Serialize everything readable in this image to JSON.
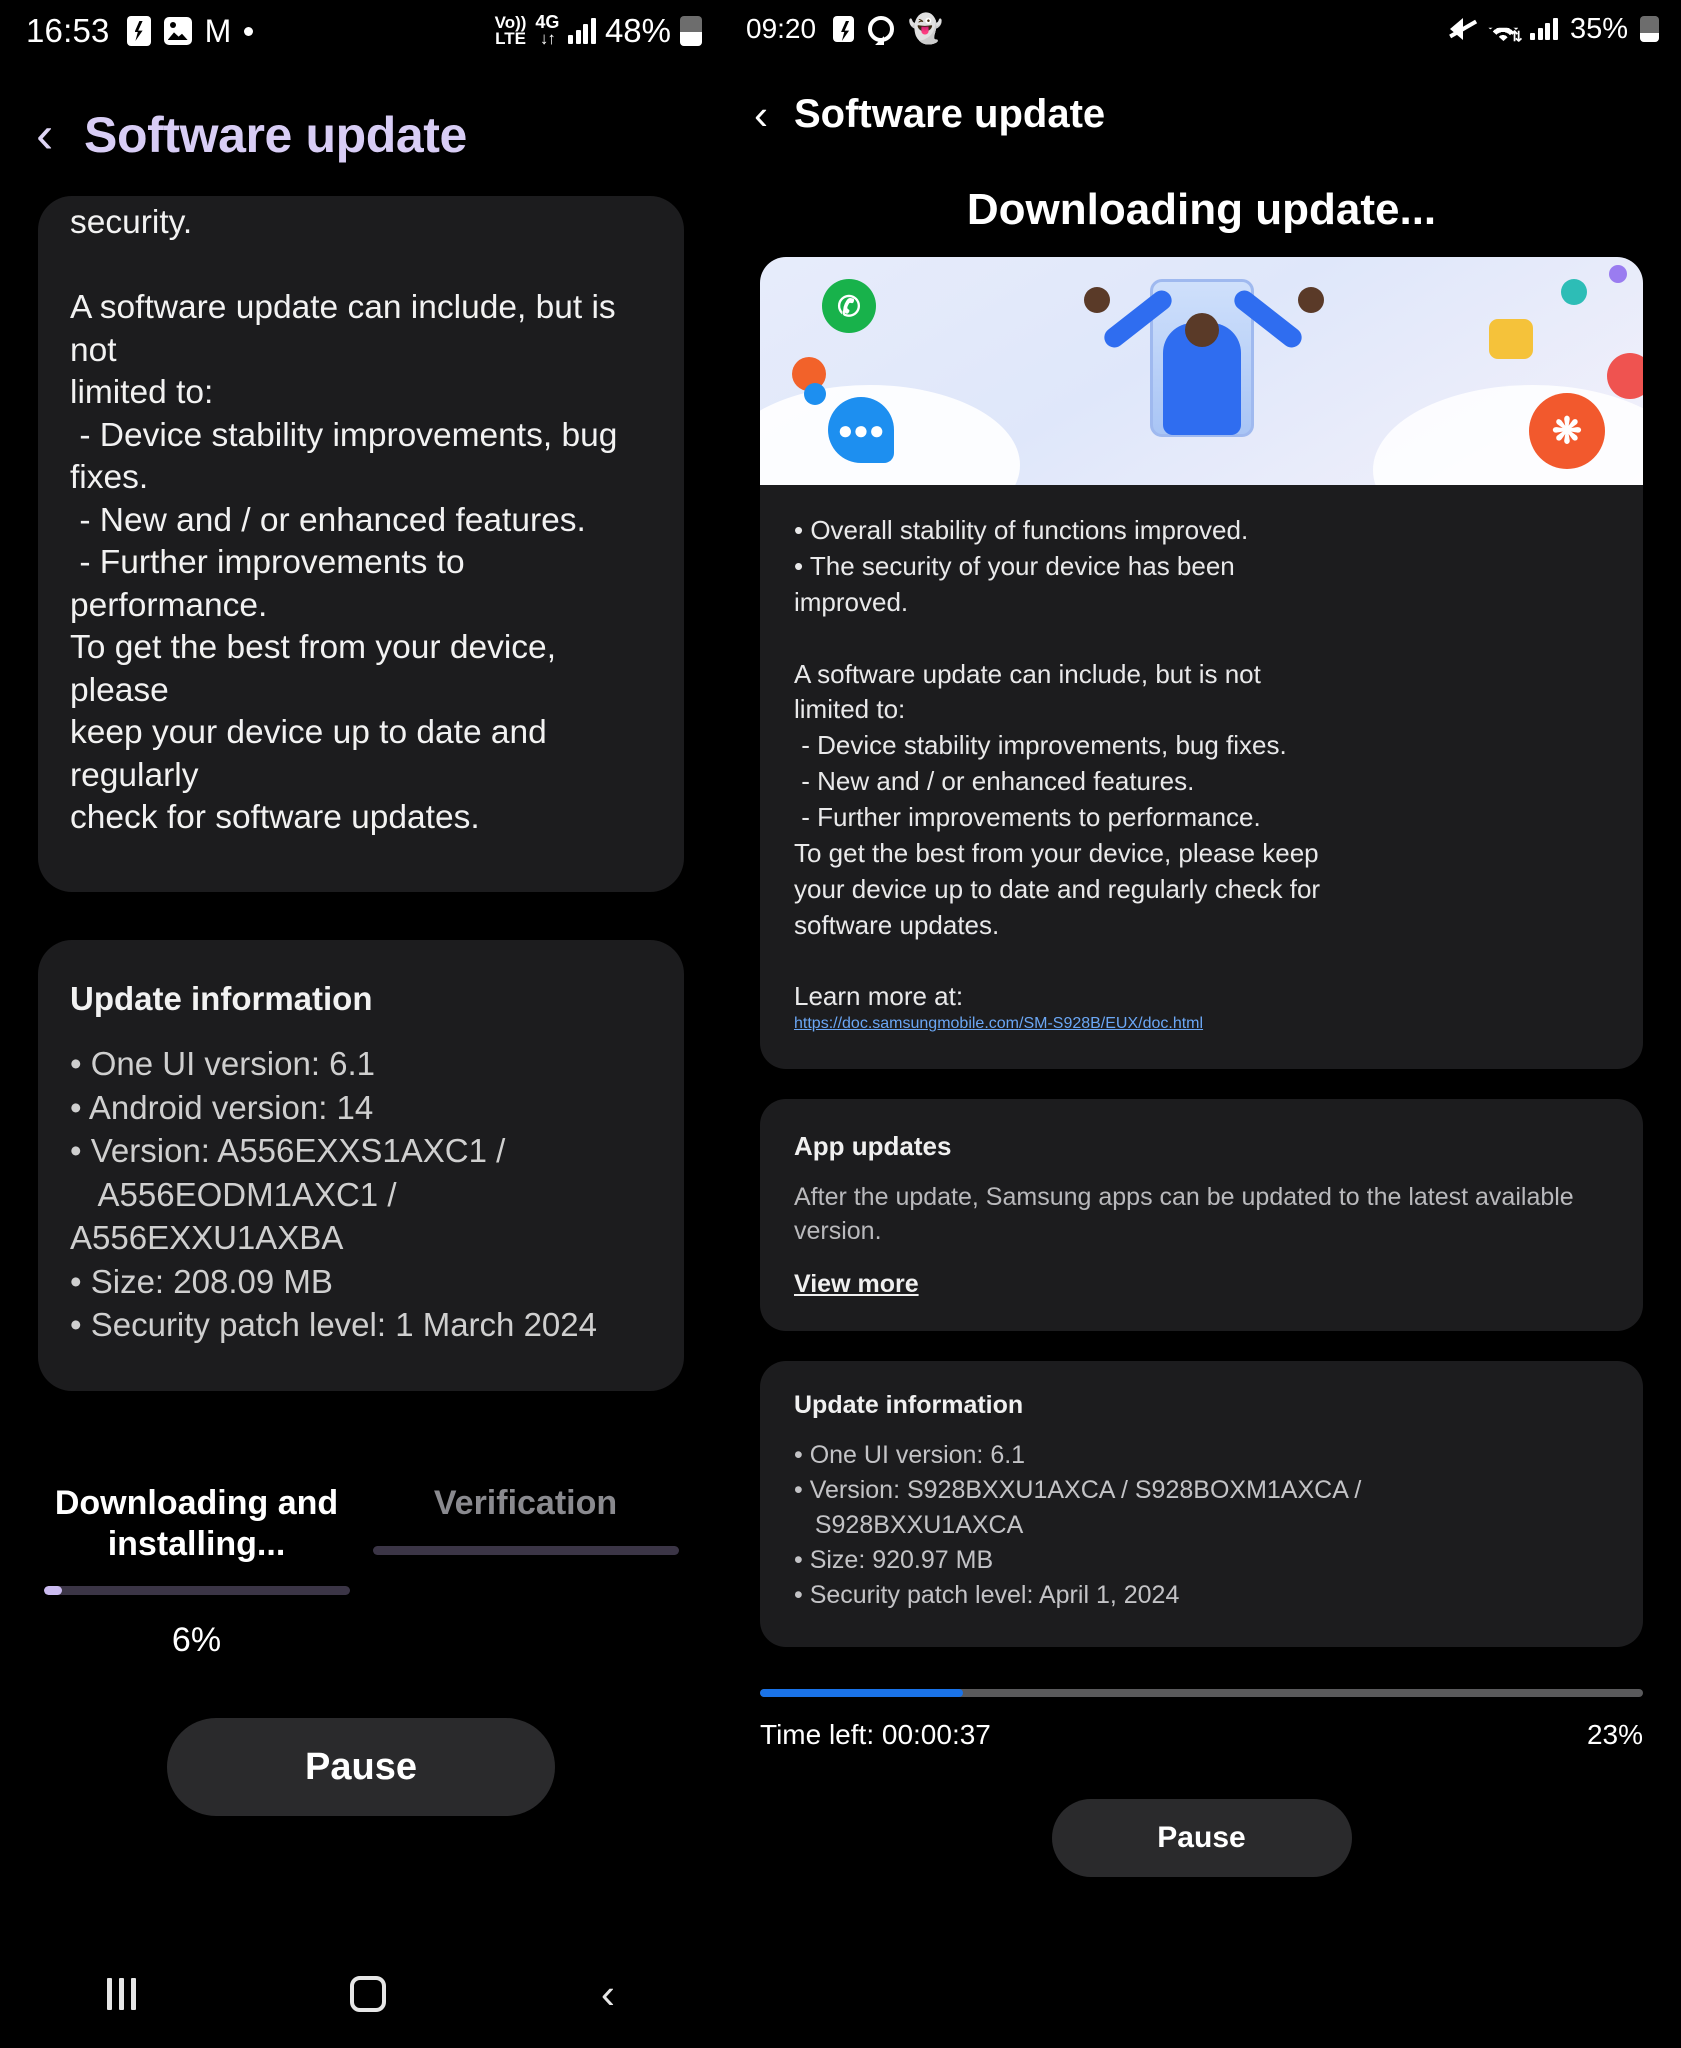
{
  "left": {
    "status_bar": {
      "time": "16:53",
      "icons": [
        "doc-icon",
        "photo-icon",
        "gmail-icon",
        "dot-icon"
      ],
      "network_voice": "Vo))",
      "network_voice_sub": "LTE",
      "network_type": "4G",
      "network_arrows": "↓↑",
      "battery_percent": "48%",
      "battery_level": 48
    },
    "header": {
      "back_icon": "chevron-left-icon",
      "title": "Software update"
    },
    "description": "security.\n\nA software update can include, but is not\nlimited to:\n - Device stability improvements, bug\nfixes.\n - New and / or enhanced features.\n - Further improvements to performance.\nTo get the best from your device, please\nkeep your device up to date and regularly\ncheck for software updates.",
    "update_information": {
      "title": "Update information",
      "items": "• One UI version: 6.1\n• Android version: 14\n• Version: A556EXXS1AXC1 /\n   A556EODM1AXC1 / A556EXXU1AXBA\n• Size: 208.09 MB\n• Security patch level: 1 March 2024"
    },
    "progress": {
      "step1_label": "Downloading and\ninstalling...",
      "step2_label": "Verification",
      "step1_percent": 6,
      "step1_percent_text": "6%",
      "step2_percent": 0
    },
    "pause_label": "Pause",
    "navbar": {
      "recents": "recents-icon",
      "home": "home-icon",
      "back": "back-icon"
    }
  },
  "right": {
    "status_bar": {
      "time": "09:20",
      "icons": [
        "doc-icon",
        "whatsapp-icon",
        "snapchat-icon"
      ],
      "mute_icon": "mute-icon",
      "wifi_icon": "wifi-icon",
      "battery_percent": "35%",
      "battery_level": 35
    },
    "header": {
      "back_icon": "chevron-left-icon",
      "title": "Software update"
    },
    "downloading_title": "Downloading update...",
    "hero_illustration": "software-update-illustration",
    "notes": "• Overall stability of functions improved.\n• The security of your device has been\nimproved.\n\nA software update can include, but is not\nlimited to:\n - Device stability improvements, bug fixes.\n - New and / or enhanced features.\n - Further improvements to performance.\nTo get the best from your device, please keep\nyour device up to date and regularly check for\nsoftware updates.\n\nLearn more at:",
    "link_text": "https://doc.samsungmobile.com/SM-S928B/EUX/doc.html",
    "app_updates": {
      "title": "App updates",
      "body": "After the update, Samsung apps can be updated to the latest available version.",
      "view_more": "View more"
    },
    "update_information": {
      "title": "Update information",
      "items": "• One UI version: 6.1\n• Version: S928BXXU1AXCA / S928BOXM1AXCA /\n   S928BXXU1AXCA\n• Size: 920.97 MB\n• Security patch level: April 1, 2024"
    },
    "progress": {
      "percent": 23,
      "percent_text": "23%",
      "time_left": "Time left: 00:00:37"
    },
    "pause_label": "Pause"
  },
  "colors": {
    "background": "#000000",
    "card": "#1c1c1e",
    "accent_purple": "#cbbbf0",
    "title_purple": "#d8cdf5",
    "accent_blue": "#1a73e8",
    "link_blue": "#6ba7f5"
  }
}
